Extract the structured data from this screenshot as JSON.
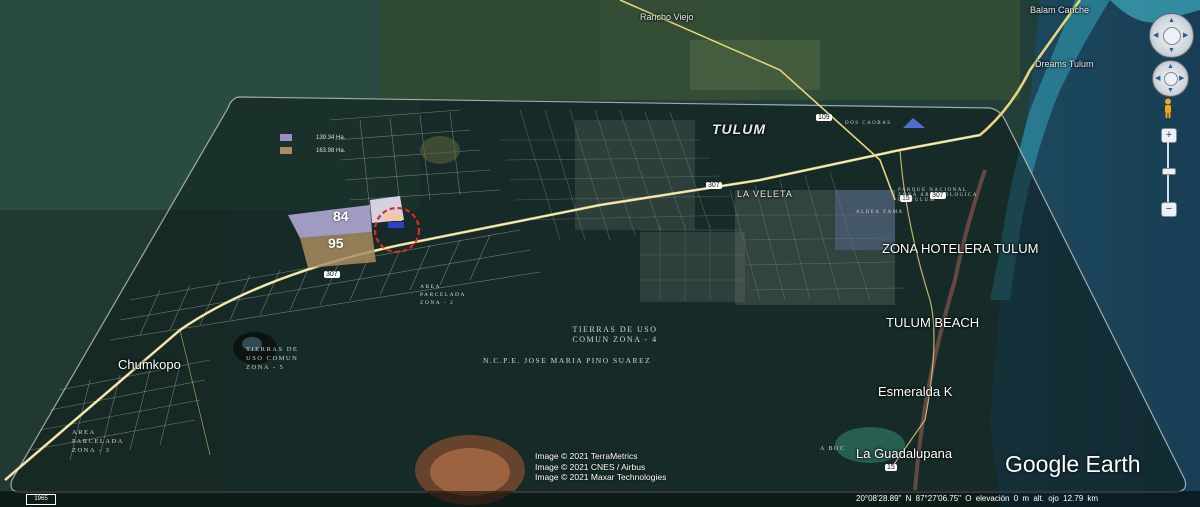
{
  "labels": {
    "rancho_viejo": "Rancho Viejo",
    "balam_canche": "Balam Canche",
    "dreams_tulum": "Dreams Tulum",
    "tulum": "TULUM",
    "la_veleta": "LA VELETA",
    "zona_hotelera": "ZONA HOTELERA TULUM",
    "tulum_beach": "TULUM BEACH",
    "esmeralda": "Esmeralda K",
    "la_guadalupana": "La Guadalupana",
    "chumkopo": "Chumkopo",
    "parque_nacional": "PARQUE NACIONAL ZONA ARQUEOLOGICA DE TULUM",
    "aldea_zama": "ALDEA ZAMA",
    "tierras_uso_comun_4": "TIERRAS DE USO COMUN ZONA - 4",
    "ncpe": "N.C.P.E. JOSE MARIA PINO SUAREZ",
    "tierras_uso_comun_5": "TIERRAS DE USO COMUN ZONA - 5",
    "area_parcelada_2": "AREA PARCELADA ZONA - 2",
    "area_parcelada_3": "AREA PARCELADA ZONA - 3",
    "dos_caobas": "DOS CAOBAS",
    "aboc": "A BOC"
  },
  "road_shields": [
    "109",
    "307",
    "307",
    "15",
    "307",
    "15"
  ],
  "legend": {
    "items": [
      {
        "color": "#9b8ec7",
        "label": "139.34 Ha."
      },
      {
        "color": "#a98c60",
        "label": "163.98 Ha."
      }
    ]
  },
  "parcels": [
    {
      "label": "84",
      "color": "#b9b0dd"
    },
    {
      "label": "95",
      "color": "#a98c60"
    }
  ],
  "credits": [
    "Image © 2021 TerraMetrics",
    "Image © 2021 CNES / Airbus",
    "Image © 2021 Maxar Technologies"
  ],
  "logo": "Google Earth",
  "status": {
    "latitude": "20°08'28.89\" N",
    "longitude": "87°27'06.75\" O",
    "elevation_label": "elevación",
    "elevation": "0 m",
    "eye_alt_label": "alt. ojo",
    "eye_alt": "12.79 km",
    "scale": "1965"
  },
  "controls": {
    "zoom_in": "+",
    "zoom_out": "−"
  },
  "colors": {
    "land": "#22413a",
    "forest": "#2c4a33",
    "ocean": "#1e4d6a",
    "reef": "#2f8ea8",
    "beach": "#d98b7e",
    "road": "#e8d47a",
    "overlay_border": "#dcdcdc",
    "marker": "#e5252a"
  }
}
